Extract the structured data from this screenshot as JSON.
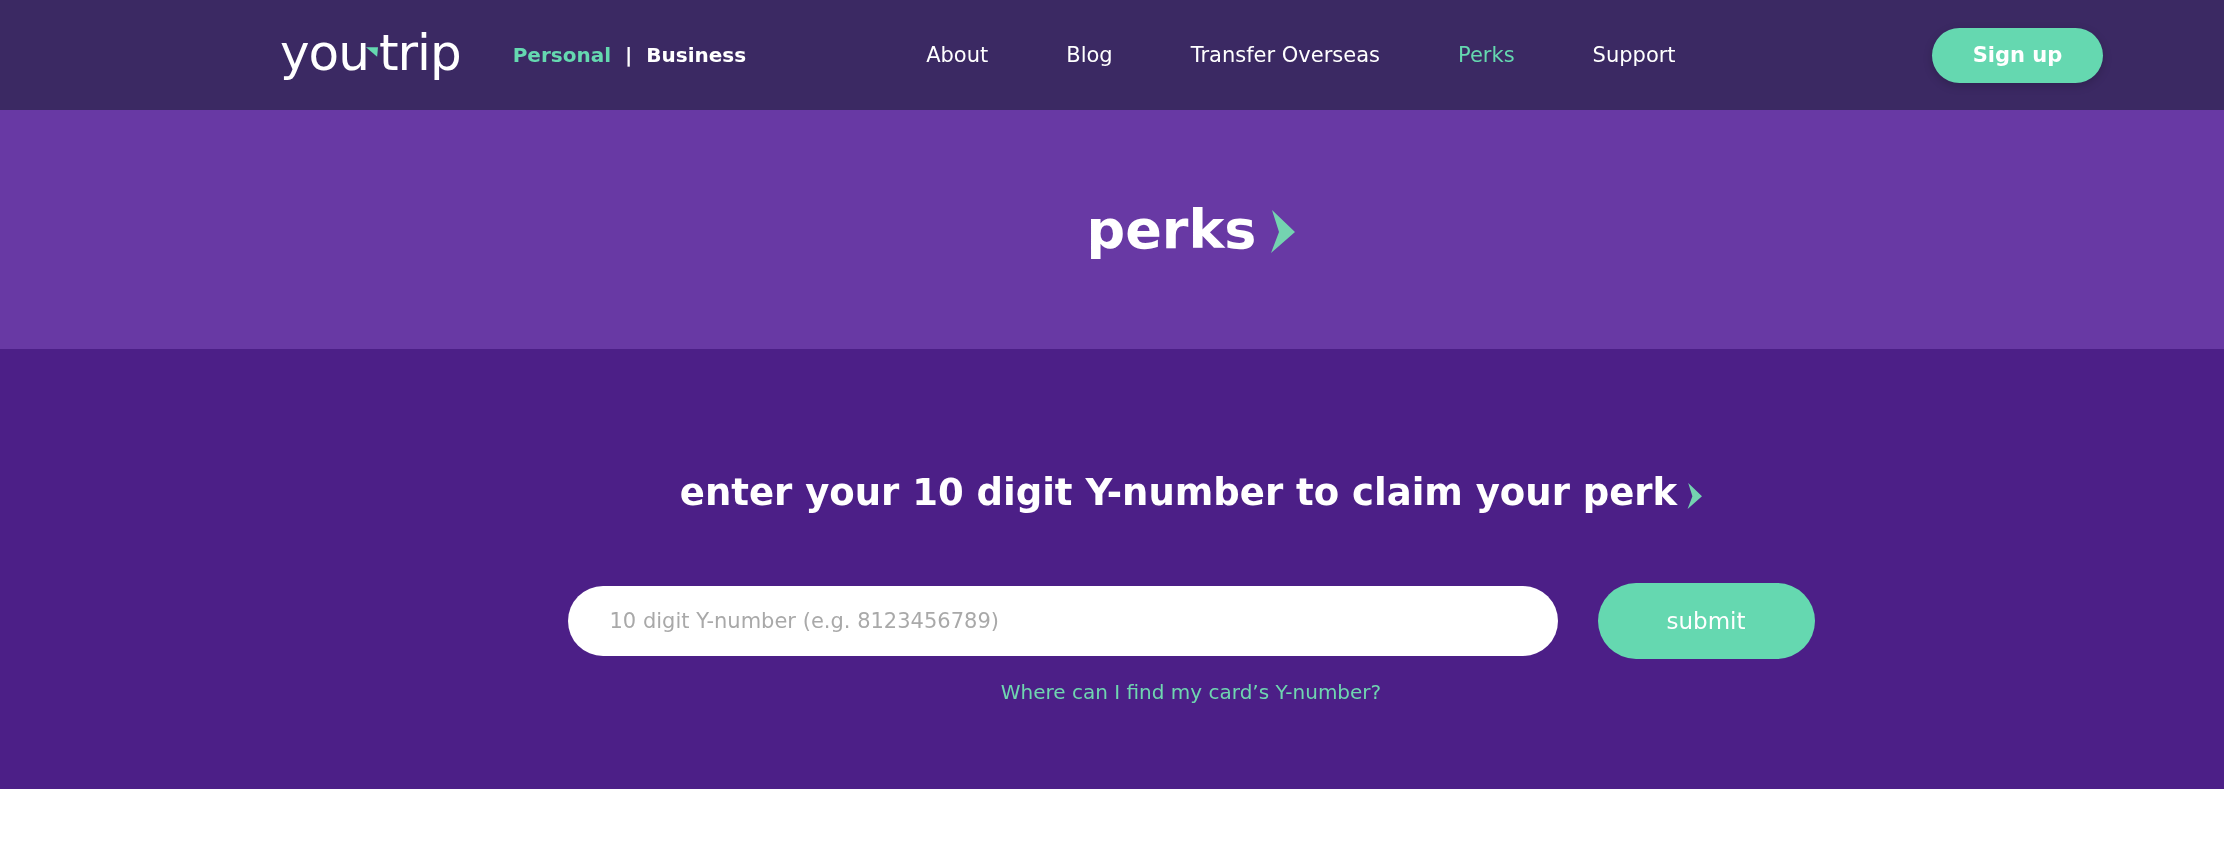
{
  "header": {
    "logo": {
      "parts": [
        "you",
        "trip"
      ]
    },
    "segments": [
      {
        "label": "Personal",
        "selected": true
      },
      {
        "label": "Business",
        "selected": false
      }
    ],
    "separator": "|",
    "nav": [
      {
        "label": "About",
        "selected": false
      },
      {
        "label": "Blog",
        "selected": false
      },
      {
        "label": "Transfer Overseas",
        "selected": false
      },
      {
        "label": "Perks",
        "selected": true
      },
      {
        "label": "Support",
        "selected": false
      }
    ],
    "signup_button": "Sign up"
  },
  "banner": {
    "title": "perks"
  },
  "claim": {
    "heading": "enter your 10 digit Y-number to claim your perk",
    "input": {
      "placeholder": "10 digit Y-number (e.g. 8123456789)"
    },
    "submit_button": "submit",
    "help_link": "Where can I find my card’s Y-number?"
  }
}
